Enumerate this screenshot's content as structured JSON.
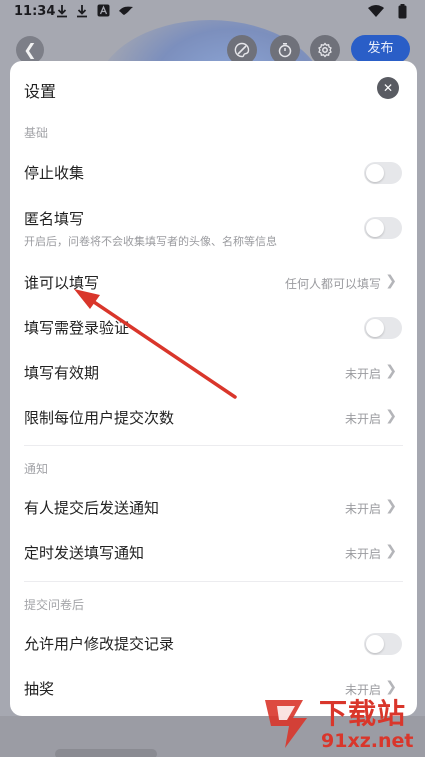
{
  "status_bar": {
    "time": "11:34"
  },
  "toolbar": {
    "publish_label": "发布"
  },
  "sheet": {
    "title": "设置",
    "sections": {
      "basic": "基础",
      "notify": "通知",
      "after_submit": "提交问卷后"
    },
    "rows": {
      "stop_collect": {
        "label": "停止收集",
        "toggle_on": false
      },
      "anonymous": {
        "label": "匿名填写",
        "sub": "开启后，问卷将不会收集填写者的头像、名称等信息",
        "toggle_on": false
      },
      "who_can_fill": {
        "label": "谁可以填写",
        "value": "任何人都可以填写"
      },
      "login_verify": {
        "label": "填写需登录验证",
        "toggle_on": false
      },
      "validity": {
        "label": "填写有效期",
        "value": "未开启"
      },
      "limit_per_user": {
        "label": "限制每位用户提交次数",
        "value": "未开启"
      },
      "notify_on_submit": {
        "label": "有人提交后发送通知",
        "value": "未开启"
      },
      "scheduled_notify": {
        "label": "定时发送填写通知",
        "value": "未开启"
      },
      "allow_edit": {
        "label": "允许用户修改提交记录",
        "toggle_on": false
      },
      "lottery": {
        "label": "抽奖",
        "value": "未开启"
      }
    }
  },
  "watermark": {
    "title": "下载站",
    "url": "91xz.net"
  },
  "colors": {
    "accent": "#2a5ec7",
    "annotation": "#d9362b",
    "toggle_off": "#e6e7ea"
  }
}
